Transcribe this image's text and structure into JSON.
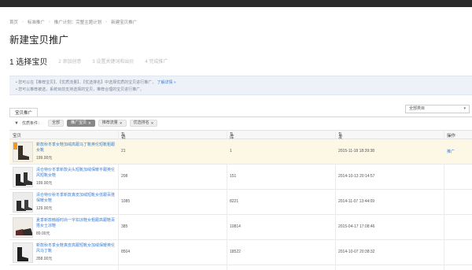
{
  "breadcrumb": [
    "首页",
    "标准推广",
    "推广计划：完整主题计划",
    "新建宝贝推广"
  ],
  "page_title": "新建宝贝推广",
  "steps": [
    "1 选择宝贝",
    "2 添加创意",
    "3 设置关键词和出价",
    "4 完成推广"
  ],
  "notice": {
    "line1": "• 您可以在【推荐宝贝】、【优质流量】、【优选排名】中选择优质的宝贝进行推广，",
    "link": "了解详情 »",
    "line2": "• 您可以推荐被选，系统目前支持选择的宝贝，推荐合理的宝贝进行推广。"
  },
  "tab_label": "宝贝推广",
  "select_value": "全部类目",
  "filters": {
    "label": "优质条件：",
    "chips": [
      "全部",
      "推广宝贝",
      "推荐流量",
      "优选排名"
    ]
  },
  "table": {
    "headers": [
      "宝贝",
      "销量",
      "库存",
      "发布日期",
      "操作"
    ],
    "rows": [
      {
        "title": "新款秋冬季女鞋加绒高跟马丁靴英伦短靴粗跟女靴",
        "price": "199.00元",
        "sales": "21",
        "stock": "1",
        "date": "2015-11-18 18:39:38",
        "action": "推广"
      },
      {
        "title": "清仓特价冬季新款尖头短靴加绒保暖平跟英伦风短靴女鞋",
        "price": "199.00元",
        "sales": "208",
        "stock": "151",
        "date": "2014-10-13 20:14:57",
        "action": ""
      },
      {
        "title": "清仓特价秋冬季新款真皮加绒短靴女低跟百搭保暖女鞋",
        "price": "129.00元",
        "sales": "1085",
        "stock": "8221",
        "date": "2014-11-07 13:44:09",
        "action": ""
      },
      {
        "title": "夏季新款韩版时尚一字扣凉鞋女粗跟高跟鞋百搭女士凉鞋",
        "price": "89.00元",
        "sales": "385",
        "stock": "10814",
        "date": "2015-04-17 17:08:46",
        "action": ""
      },
      {
        "title": "新款秋冬季女鞋真皮高跟短靴女加绒保暖英伦风马丁靴",
        "price": "358.00元",
        "sales": "8504",
        "stock": "18522",
        "date": "2014-10-07 20:38:32",
        "action": ""
      }
    ]
  }
}
